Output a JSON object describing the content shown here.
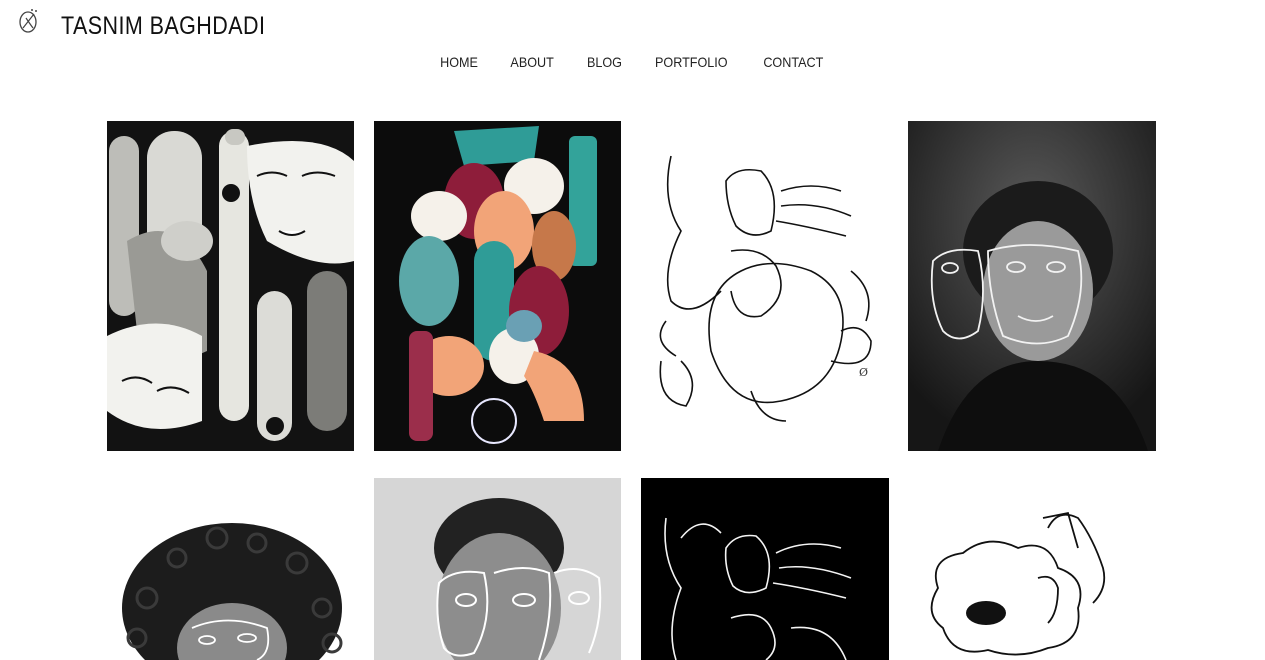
{
  "site": {
    "title": "TASNIM BAGHDADI"
  },
  "nav": {
    "items": [
      {
        "label": "HOME"
      },
      {
        "label": "ABOUT"
      },
      {
        "label": "BLOG"
      },
      {
        "label": "PORTFOLIO"
      },
      {
        "label": "CONTACT"
      }
    ]
  },
  "gallery": {
    "tiles": [
      {
        "name": "artwork-black-white-faces"
      },
      {
        "name": "artwork-colorful-abstract"
      },
      {
        "name": "artwork-line-drawing-woman"
      },
      {
        "name": "artwork-photo-portrait-lines"
      },
      {
        "name": "artwork-curly-hair-portrait"
      },
      {
        "name": "artwork-photo-woman-line-faces"
      },
      {
        "name": "artwork-white-lines-on-black"
      },
      {
        "name": "artwork-line-drawing-flower"
      }
    ]
  },
  "colors": {
    "text": "#222222",
    "teal": "#2f9c97",
    "crimson": "#8e1d3a",
    "peach": "#f2a478"
  }
}
